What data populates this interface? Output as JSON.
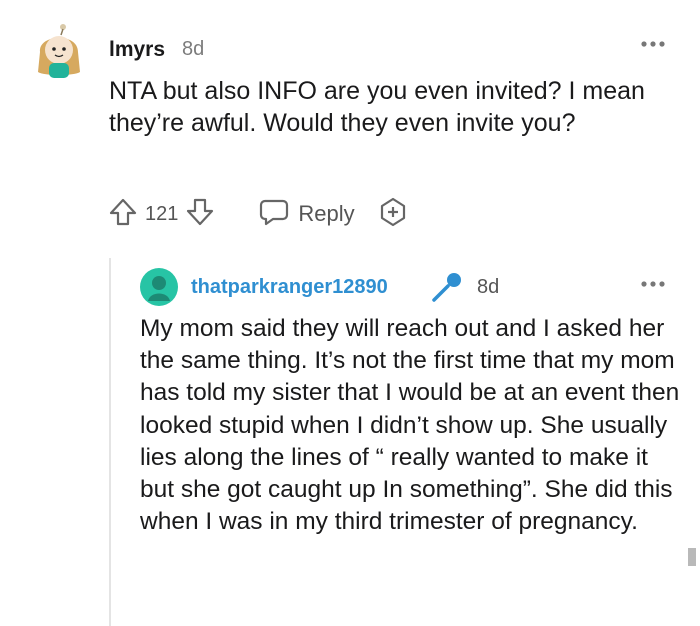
{
  "comment": {
    "username": "lmyrs",
    "time": "8d",
    "body": "NTA but also INFO are you even invited? I mean they’re awful. Would they even invite you?",
    "vote_count": "121",
    "reply_label": "Reply"
  },
  "reply": {
    "username": "thatparkranger12890",
    "time": "8d",
    "body": "My mom said they will reach out and I asked her the same thing. It’s not the first time that my mom has told my sister that I would be at an event then looked stupid when I didn’t show up. She usually lies along the lines of “ really wanted to make it but she got caught up In something”. She did this when I was in my third trimester of pregnancy."
  },
  "colors": {
    "username_link": "#2f8fd1",
    "avatar2_bg": "#27c4a5"
  },
  "icons": [
    "avatar",
    "more-options-icon",
    "upvote-icon",
    "downvote-icon",
    "reply-icon",
    "award-icon",
    "microphone-icon"
  ]
}
